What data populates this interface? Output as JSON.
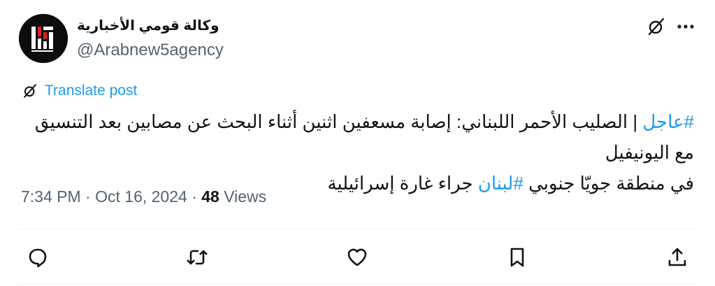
{
  "account": {
    "display_name": "وكالة قومي الأخبارية",
    "handle": "@Arabnew5agency"
  },
  "translate": {
    "label": "Translate post"
  },
  "tweet": {
    "hashtag_1": "#عاجل",
    "line_1_rest": "| الصليب الأحمر اللبناني: إصابة مسعفين اثنين أثناء البحث عن مصابين بعد التنسيق مع اليونيفيل",
    "line_2_start": "في منطقة جويّا جنوبي",
    "hashtag_2": "#لبنان",
    "line_2_end": "جراء غارة إسرائيلية"
  },
  "meta": {
    "time": "7:34 PM",
    "separator_1": " · ",
    "date": "Oct 16, 2024",
    "separator_2": " · ",
    "views_count": "48",
    "views_label": " Views"
  },
  "icons": {
    "translate": "translate-icon",
    "grok": "grok-icon",
    "more": "more-icon",
    "reply": "reply-icon",
    "repost": "repost-icon",
    "like": "like-icon",
    "bookmark": "bookmark-icon",
    "share": "share-icon"
  },
  "colors": {
    "accent": "#1d9bf0",
    "secondary_text": "#536471",
    "text": "#0f1419"
  }
}
